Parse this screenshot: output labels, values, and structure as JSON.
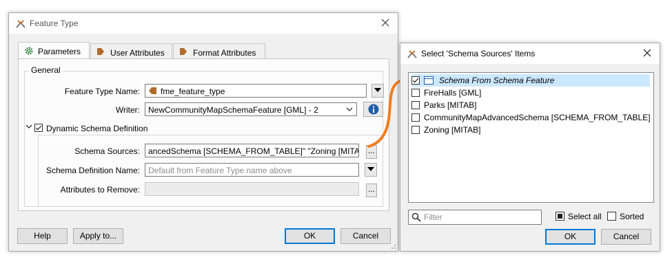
{
  "feature_dialog": {
    "title": "Feature Type",
    "tabs": [
      {
        "label": "Parameters"
      },
      {
        "label": "User Attributes"
      },
      {
        "label": "Format Attributes"
      }
    ],
    "group_title": "General",
    "feature_type_name_label": "Feature Type Name:",
    "feature_type_name_value": "fme_feature_type",
    "writer_label": "Writer:",
    "writer_value": "NewCommunityMapSchemaFeature [GML] - 2",
    "dynamic_schema_label": "Dynamic Schema Definition",
    "dynamic_schema_checked": true,
    "schema_sources_label": "Schema Sources:",
    "schema_sources_value": "ancedSchema [SCHEMA_FROM_TABLE]\" \"Zoning [MITAB]\"",
    "schema_definition_label": "Schema Definition Name:",
    "schema_definition_placeholder": "Default from Feature Type name above",
    "attributes_remove_label": "Attributes to Remove:",
    "ellipsis": "...",
    "buttons": {
      "help": "Help",
      "apply_to": "Apply to...",
      "ok": "OK",
      "cancel": "Cancel"
    }
  },
  "select_dialog": {
    "title": "Select 'Schema Sources' Items",
    "items": [
      {
        "label": "Schema From Schema Feature",
        "checked": true
      },
      {
        "label": "FireHalls [GML]",
        "checked": false
      },
      {
        "label": "Parks [MITAB]",
        "checked": false
      },
      {
        "label": "CommunityMapAdvancedSchema [SCHEMA_FROM_TABLE]",
        "checked": false
      },
      {
        "label": "Zoning [MITAB]",
        "checked": false
      }
    ],
    "filter_placeholder": "Filter",
    "select_all_label": "Select all",
    "sorted_label": "Sorted",
    "buttons": {
      "ok": "OK",
      "cancel": "Cancel"
    }
  },
  "colors": {
    "accent": "#0078d7",
    "arrow": "#f07d1e",
    "selection": "#cce8ff"
  }
}
